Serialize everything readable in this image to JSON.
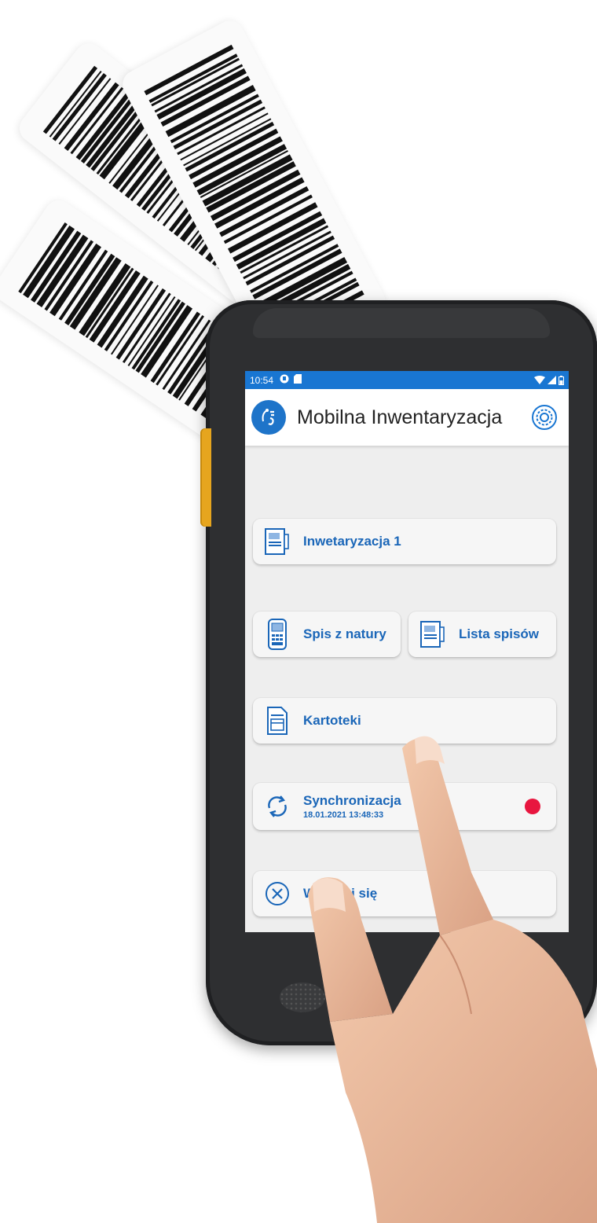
{
  "status_bar": {
    "time": "10:54",
    "left_icons": [
      "notification-icon",
      "sd-card-icon"
    ],
    "right_icons": [
      "wifi-icon",
      "signal-icon",
      "battery-icon"
    ]
  },
  "app": {
    "title": "Mobilna Inwentaryzacja",
    "logo_icon": "app-logo-icon",
    "settings_icon": "gear-icon"
  },
  "menu": {
    "inventory": {
      "label": "Inwetaryzacja 1",
      "icon": "document-icon"
    },
    "stocktake": {
      "label": "Spis z natury",
      "icon": "scanner-icon"
    },
    "list": {
      "label": "Lista spisów",
      "icon": "document-icon"
    },
    "records": {
      "label": "Kartoteki",
      "icon": "file-card-icon"
    },
    "sync": {
      "label": "Synchronizacja",
      "date": "18.01.2021 13:48:33",
      "icon": "sync-icon",
      "status_color": "#e8163f"
    },
    "logout": {
      "label": "Wyloguj się",
      "icon": "close-circle-icon"
    }
  },
  "colors": {
    "accent": "#1976d2",
    "button_text": "#1a66b8",
    "status_dot": "#e8163f"
  }
}
